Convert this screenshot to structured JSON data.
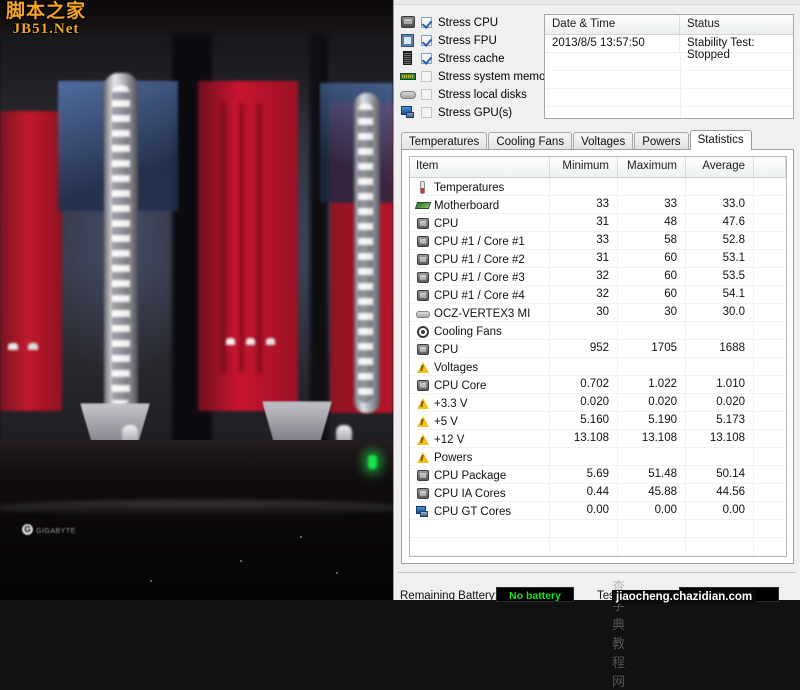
{
  "photo": {
    "watermark_top": {
      "cn": "脚本之家",
      "en": "JB51.Net"
    },
    "brand_badge": {
      "mark": "G",
      "text": "GIGABYTE"
    }
  },
  "stress": {
    "items": [
      {
        "label": "Stress CPU",
        "checked": true,
        "icon": "cpu-icon"
      },
      {
        "label": "Stress FPU",
        "checked": true,
        "icon": "fpu-icon"
      },
      {
        "label": "Stress cache",
        "checked": true,
        "icon": "cache-icon"
      },
      {
        "label": "Stress system memory",
        "checked": false,
        "icon": "memory-icon"
      },
      {
        "label": "Stress local disks",
        "checked": false,
        "icon": "disk-icon"
      },
      {
        "label": "Stress GPU(s)",
        "checked": false,
        "icon": "gpu-icon"
      }
    ]
  },
  "log": {
    "columns": [
      "Date & Time",
      "Status"
    ],
    "rows": [
      [
        "2013/8/5 13:57:50",
        "Stability Test: Stopped"
      ]
    ],
    "empty_rows": 4
  },
  "tabs": {
    "items": [
      "Temperatures",
      "Cooling Fans",
      "Voltages",
      "Powers",
      "Statistics"
    ],
    "active": "Statistics"
  },
  "grid": {
    "columns": [
      "Item",
      "Minimum",
      "Maximum",
      "Average"
    ],
    "rows": [
      {
        "label": "Temperatures",
        "icon": "thermometer-icon",
        "level": 0,
        "min": "",
        "max": "",
        "avg": ""
      },
      {
        "label": "Motherboard",
        "icon": "motherboard-icon",
        "level": 1,
        "min": "33",
        "max": "33",
        "avg": "33.0"
      },
      {
        "label": "CPU",
        "icon": "chip-icon",
        "level": 1,
        "min": "31",
        "max": "48",
        "avg": "47.6"
      },
      {
        "label": "CPU #1 / Core #1",
        "icon": "chip-icon",
        "level": 1,
        "min": "33",
        "max": "58",
        "avg": "52.8"
      },
      {
        "label": "CPU #1 / Core #2",
        "icon": "chip-icon",
        "level": 1,
        "min": "31",
        "max": "60",
        "avg": "53.1"
      },
      {
        "label": "CPU #1 / Core #3",
        "icon": "chip-icon",
        "level": 1,
        "min": "32",
        "max": "60",
        "avg": "53.5"
      },
      {
        "label": "CPU #1 / Core #4",
        "icon": "chip-icon",
        "level": 1,
        "min": "32",
        "max": "60",
        "avg": "54.1"
      },
      {
        "label": "OCZ-VERTEX3 MI",
        "icon": "ssd-icon",
        "level": 1,
        "min": "30",
        "max": "30",
        "avg": "30.0"
      },
      {
        "label": "Cooling Fans",
        "icon": "fan-icon",
        "level": 0,
        "min": "",
        "max": "",
        "avg": ""
      },
      {
        "label": "CPU",
        "icon": "chip-icon",
        "level": 1,
        "min": "952",
        "max": "1705",
        "avg": "1688"
      },
      {
        "label": "Voltages",
        "icon": "warning-icon",
        "level": 0,
        "min": "",
        "max": "",
        "avg": ""
      },
      {
        "label": "CPU Core",
        "icon": "chip-icon",
        "level": 1,
        "min": "0.702",
        "max": "1.022",
        "avg": "1.010"
      },
      {
        "label": "+3.3 V",
        "icon": "warning-icon",
        "level": 1,
        "min": "0.020",
        "max": "0.020",
        "avg": "0.020"
      },
      {
        "label": "+5 V",
        "icon": "warning-icon",
        "level": 1,
        "min": "5.160",
        "max": "5.190",
        "avg": "5.173"
      },
      {
        "label": "+12 V",
        "icon": "warning-icon",
        "level": 1,
        "min": "13.108",
        "max": "13.108",
        "avg": "13.108"
      },
      {
        "label": "Powers",
        "icon": "warning-icon",
        "level": 0,
        "min": "",
        "max": "",
        "avg": ""
      },
      {
        "label": "CPU Package",
        "icon": "chip-icon",
        "level": 1,
        "min": "5.69",
        "max": "51.48",
        "avg": "50.14"
      },
      {
        "label": "CPU IA Cores",
        "icon": "chip-icon",
        "level": 1,
        "min": "0.44",
        "max": "45.88",
        "avg": "44.56"
      },
      {
        "label": "CPU GT Cores",
        "icon": "vga-icon",
        "level": 1,
        "min": "0.00",
        "max": "0.00",
        "avg": "0.00"
      }
    ],
    "blank_rows": 4
  },
  "statusbar": {
    "battery_label": "Remaining Battery:",
    "battery_value": "No battery",
    "test_label": "Test Started:",
    "lcd_color": "#19e019"
  },
  "watermark_bottom": {
    "cn": "查字典 教程网",
    "url": "jiaocheng.chazidian.com"
  }
}
